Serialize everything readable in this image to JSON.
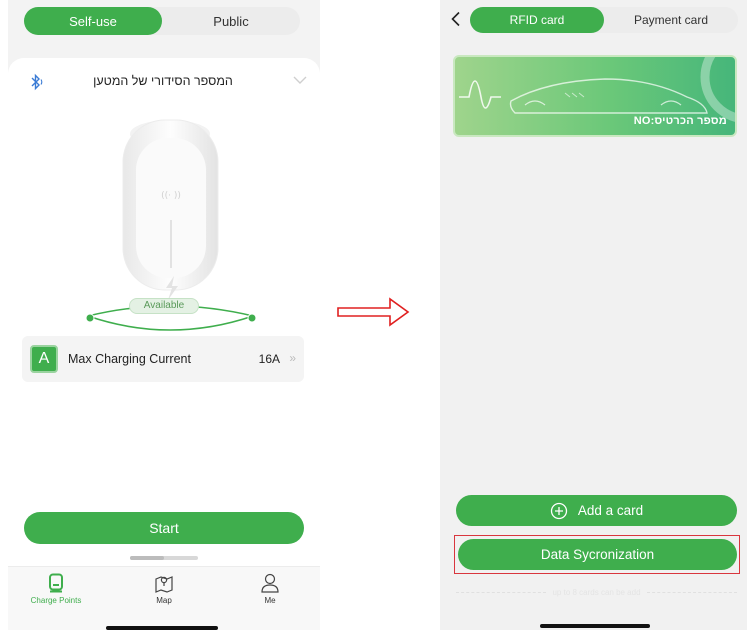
{
  "left_screen": {
    "tabs": [
      {
        "label": "Self-use",
        "active": true
      },
      {
        "label": "Public",
        "active": false
      }
    ],
    "charger": {
      "serial_label": "המספר הסידורי של המטען",
      "status": "Available",
      "bluetooth_icon": "bluetooth-icon",
      "expand_icon": "chevron-down-icon"
    },
    "current_setting": {
      "icon_letter": "A",
      "label": "Max Charging Current",
      "value": "16A",
      "arrow": "»"
    },
    "start_button": "Start",
    "bottom_nav": [
      {
        "label": "Charge Points",
        "icon": "charger-icon",
        "active": true
      },
      {
        "label": "Map",
        "icon": "map-icon",
        "active": false
      },
      {
        "label": "Me",
        "icon": "person-icon",
        "active": false
      }
    ]
  },
  "right_screen": {
    "tabs": [
      {
        "label": "RFID card",
        "active": true
      },
      {
        "label": "Payment card",
        "active": false
      }
    ],
    "card": {
      "number_label": "מספר הכרטיס:NO"
    },
    "add_card_button": "Add a card",
    "sync_button": "Data Sycronization",
    "limit_note": "up to 8 cards can be add"
  },
  "colors": {
    "accent": "#3fae4d",
    "highlight_border": "#d9363e",
    "arrow": "#e02020"
  }
}
